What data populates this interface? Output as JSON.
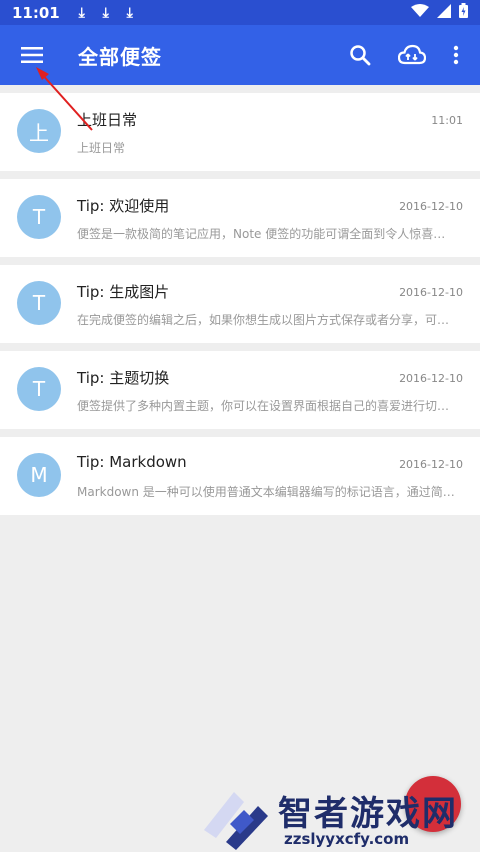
{
  "status_bar": {
    "time": "11:01",
    "download_icons": [
      "download-icon",
      "download-icon",
      "download-icon"
    ],
    "right_icons": [
      "wifi-icon",
      "signal-icon",
      "battery-icon"
    ]
  },
  "app_bar": {
    "title": "全部便签",
    "color": "#3361e7"
  },
  "notes": [
    {
      "avatar": "上",
      "title": "上班日常",
      "date": "11:01",
      "preview": "上班日常"
    },
    {
      "avatar": "T",
      "title": "Tip: 欢迎使用",
      "date": "2016-12-10",
      "preview": "便签是一款极简的笔记应用，Note 便签的功能可谓全面到令人惊喜…"
    },
    {
      "avatar": "T",
      "title": "Tip: 生成图片",
      "date": "2016-12-10",
      "preview": "在完成便签的编辑之后，如果你想生成以图片方式保存或者分享，可…"
    },
    {
      "avatar": "T",
      "title": "Tip: 主题切换",
      "date": "2016-12-10",
      "preview": "便签提供了多种内置主题，你可以在设置界面根据自己的喜爱进行切…"
    },
    {
      "avatar": "M",
      "title": "Tip: Markdown",
      "date": "2016-12-10",
      "preview": "Markdown 是一种可以使用普通文本编辑器编写的标记语言，通过简…"
    }
  ],
  "watermark": {
    "name": "智者游戏网",
    "url": "zzslyyxcfy.com"
  }
}
